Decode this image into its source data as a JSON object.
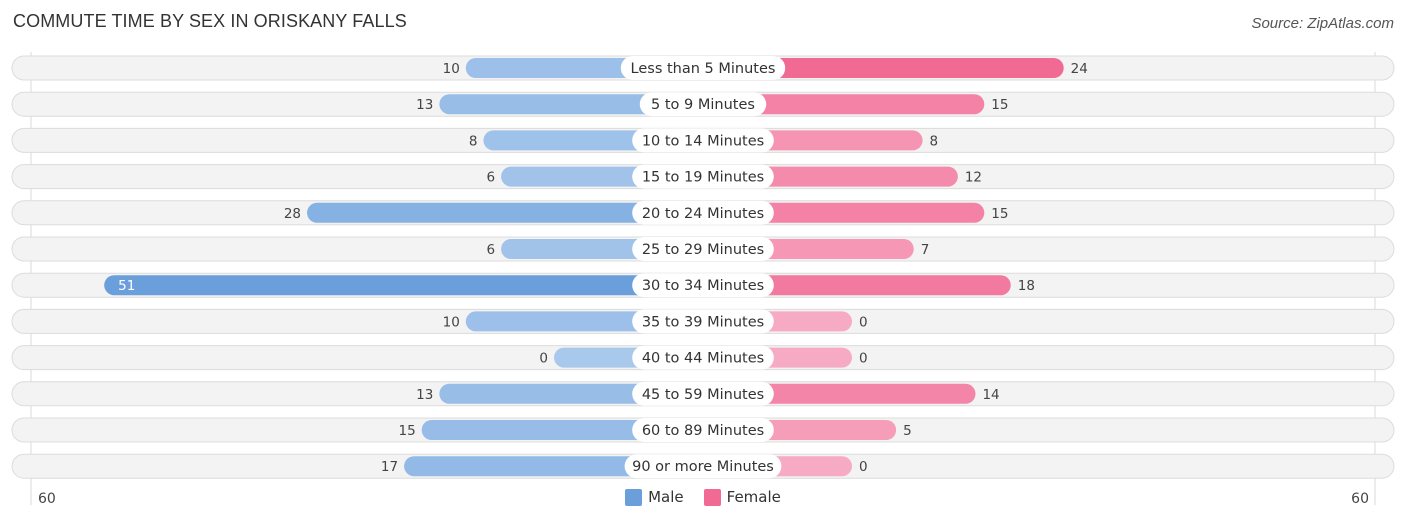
{
  "header": {
    "title": "COMMUTE TIME BY SEX IN ORISKANY FALLS",
    "source": "Source: ZipAtlas.com"
  },
  "colors": {
    "male": "#6a9fdc",
    "male_light": "#a8c8ec",
    "female": "#f06a94",
    "female_light": "#f7aac3"
  },
  "chart_data": {
    "type": "bar",
    "orientation": "horizontal-diverging",
    "title": "COMMUTE TIME BY SEX IN ORISKANY FALLS",
    "categories": [
      "Less than 5 Minutes",
      "5 to 9 Minutes",
      "10 to 14 Minutes",
      "15 to 19 Minutes",
      "20 to 24 Minutes",
      "25 to 29 Minutes",
      "30 to 34 Minutes",
      "35 to 39 Minutes",
      "40 to 44 Minutes",
      "45 to 59 Minutes",
      "60 to 89 Minutes",
      "90 or more Minutes"
    ],
    "series": [
      {
        "name": "Male",
        "values": [
          10,
          13,
          8,
          6,
          28,
          6,
          51,
          10,
          0,
          13,
          15,
          17
        ]
      },
      {
        "name": "Female",
        "values": [
          24,
          15,
          8,
          12,
          15,
          7,
          18,
          0,
          0,
          14,
          5,
          0
        ]
      }
    ],
    "axis": {
      "left_label": "60",
      "right_label": "60",
      "range": [
        -60,
        60
      ]
    },
    "legend": {
      "position": "bottom-center",
      "entries": [
        "Male",
        "Female"
      ]
    },
    "grid": false
  }
}
